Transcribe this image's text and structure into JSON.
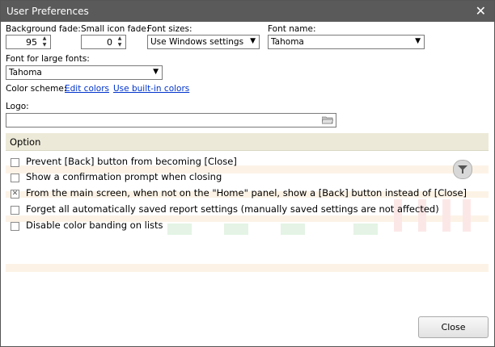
{
  "window": {
    "title": "User Preferences"
  },
  "background_fade": {
    "label": "Background fade:",
    "value": "95"
  },
  "small_icon_fade": {
    "label": "Small icon fade:",
    "value": "0"
  },
  "font_sizes": {
    "label": "Font sizes:",
    "value": "Use Windows settings"
  },
  "font_name": {
    "label": "Font name:",
    "value": "Tahoma"
  },
  "large_font": {
    "label": "Font for large fonts:",
    "value": "Tahoma"
  },
  "color_scheme": {
    "label": "Color scheme:",
    "edit_link": "Edit colors",
    "builtin_link": "Use built-in colors"
  },
  "logo": {
    "label": "Logo:",
    "value": ""
  },
  "options": {
    "header": "Option",
    "items": [
      {
        "label": "Prevent [Back] button from becoming [Close]",
        "checked": false
      },
      {
        "label": "Show a confirmation prompt when closing",
        "checked": false
      },
      {
        "label": "From the main screen, when not on the \"Home\" panel, show a [Back] button instead of [Close]",
        "checked": true
      },
      {
        "label": "Forget all automatically saved report settings (manually saved settings are not affected)",
        "checked": false
      },
      {
        "label": "Disable color banding on lists",
        "checked": false
      }
    ]
  },
  "buttons": {
    "close": "Close"
  },
  "icons": {
    "filter": "filter-icon",
    "folder": "folder-icon",
    "close": "close-icon"
  }
}
